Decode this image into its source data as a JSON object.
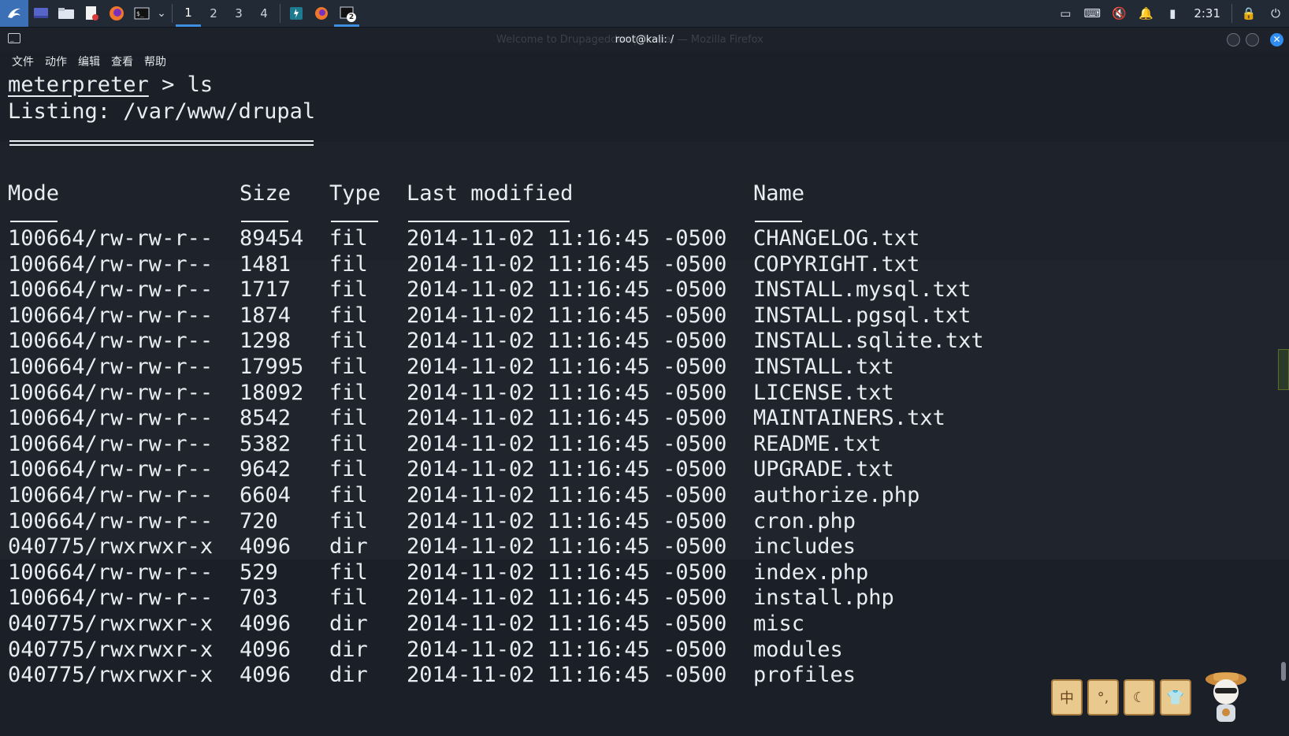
{
  "taskbar": {
    "workspaces": [
      "1",
      "2",
      "3",
      "4"
    ],
    "active_workspace": "1",
    "terminal_window_count": "2",
    "clock": "2:31"
  },
  "window": {
    "title": "root@kali: /",
    "ghost_title": "Welcome to Drupageddon | Drupal — Mozilla Firefox"
  },
  "menu": [
    "文件",
    "动作",
    "编辑",
    "查看",
    "帮助"
  ],
  "terminal": {
    "prompt": "meterpreter",
    "command": " > ls",
    "listing": "Listing: /var/www/drupal",
    "headers": {
      "mode": "Mode",
      "size": "Size",
      "type": "Type",
      "modified": "Last modified",
      "name": "Name"
    },
    "rows": [
      {
        "mode": "100664/rw-rw-r--",
        "size": "89454",
        "type": "fil",
        "modified": "2014-11-02 11:16:45 -0500",
        "name": "CHANGELOG.txt"
      },
      {
        "mode": "100664/rw-rw-r--",
        "size": "1481",
        "type": "fil",
        "modified": "2014-11-02 11:16:45 -0500",
        "name": "COPYRIGHT.txt"
      },
      {
        "mode": "100664/rw-rw-r--",
        "size": "1717",
        "type": "fil",
        "modified": "2014-11-02 11:16:45 -0500",
        "name": "INSTALL.mysql.txt"
      },
      {
        "mode": "100664/rw-rw-r--",
        "size": "1874",
        "type": "fil",
        "modified": "2014-11-02 11:16:45 -0500",
        "name": "INSTALL.pgsql.txt"
      },
      {
        "mode": "100664/rw-rw-r--",
        "size": "1298",
        "type": "fil",
        "modified": "2014-11-02 11:16:45 -0500",
        "name": "INSTALL.sqlite.txt"
      },
      {
        "mode": "100664/rw-rw-r--",
        "size": "17995",
        "type": "fil",
        "modified": "2014-11-02 11:16:45 -0500",
        "name": "INSTALL.txt"
      },
      {
        "mode": "100664/rw-rw-r--",
        "size": "18092",
        "type": "fil",
        "modified": "2014-11-02 11:16:45 -0500",
        "name": "LICENSE.txt"
      },
      {
        "mode": "100664/rw-rw-r--",
        "size": "8542",
        "type": "fil",
        "modified": "2014-11-02 11:16:45 -0500",
        "name": "MAINTAINERS.txt"
      },
      {
        "mode": "100664/rw-rw-r--",
        "size": "5382",
        "type": "fil",
        "modified": "2014-11-02 11:16:45 -0500",
        "name": "README.txt"
      },
      {
        "mode": "100664/rw-rw-r--",
        "size": "9642",
        "type": "fil",
        "modified": "2014-11-02 11:16:45 -0500",
        "name": "UPGRADE.txt"
      },
      {
        "mode": "100664/rw-rw-r--",
        "size": "6604",
        "type": "fil",
        "modified": "2014-11-02 11:16:45 -0500",
        "name": "authorize.php"
      },
      {
        "mode": "100664/rw-rw-r--",
        "size": "720",
        "type": "fil",
        "modified": "2014-11-02 11:16:45 -0500",
        "name": "cron.php"
      },
      {
        "mode": "040775/rwxrwxr-x",
        "size": "4096",
        "type": "dir",
        "modified": "2014-11-02 11:16:45 -0500",
        "name": "includes"
      },
      {
        "mode": "100664/rw-rw-r--",
        "size": "529",
        "type": "fil",
        "modified": "2014-11-02 11:16:45 -0500",
        "name": "index.php"
      },
      {
        "mode": "100664/rw-rw-r--",
        "size": "703",
        "type": "fil",
        "modified": "2014-11-02 11:16:45 -0500",
        "name": "install.php"
      },
      {
        "mode": "040775/rwxrwxr-x",
        "size": "4096",
        "type": "dir",
        "modified": "2014-11-02 11:16:45 -0500",
        "name": "misc"
      },
      {
        "mode": "040775/rwxrwxr-x",
        "size": "4096",
        "type": "dir",
        "modified": "2014-11-02 11:16:45 -0500",
        "name": "modules"
      },
      {
        "mode": "040775/rwxrwxr-x",
        "size": "4096",
        "type": "dir",
        "modified": "2014-11-02 11:16:45 -0500",
        "name": "profiles"
      }
    ]
  },
  "widget": {
    "tiles": [
      "中",
      "°,",
      "☾",
      "👕"
    ]
  },
  "colors": {
    "taskbar_bg": "#222a36",
    "terminal_bg": "#1b1f27",
    "accent": "#3d8fe0",
    "text": "#e9ecf0"
  }
}
